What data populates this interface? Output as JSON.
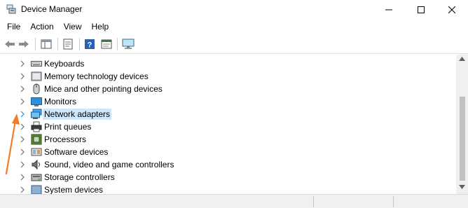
{
  "window": {
    "title": "Device Manager",
    "minimize_glyph": "—",
    "maximize_glyph": "☐",
    "close_glyph": "✕"
  },
  "menu": {
    "items": [
      "File",
      "Action",
      "View",
      "Help"
    ]
  },
  "tree": {
    "items": [
      {
        "label": "Keyboards",
        "icon": "keyboard-icon",
        "selected": false
      },
      {
        "label": "Memory technology devices",
        "icon": "memory-icon",
        "selected": false
      },
      {
        "label": "Mice and other pointing devices",
        "icon": "mouse-icon",
        "selected": false
      },
      {
        "label": "Monitors",
        "icon": "monitor-icon",
        "selected": false
      },
      {
        "label": "Network adapters",
        "icon": "network-adapter-icon",
        "selected": true
      },
      {
        "label": "Print queues",
        "icon": "printer-icon",
        "selected": false
      },
      {
        "label": "Processors",
        "icon": "processor-icon",
        "selected": false
      },
      {
        "label": "Software devices",
        "icon": "software-device-icon",
        "selected": false
      },
      {
        "label": "Sound, video and game controllers",
        "icon": "speaker-icon",
        "selected": false
      },
      {
        "label": "Storage controllers",
        "icon": "storage-controller-icon",
        "selected": false
      },
      {
        "label": "System devices",
        "icon": "system-device-icon",
        "selected": false
      }
    ]
  },
  "colors": {
    "selection_bg": "#cce8ff",
    "annotation_arrow": "#f07b29",
    "chevron": "#6e6e6e",
    "chevron_selected": "#2f8fd8"
  }
}
